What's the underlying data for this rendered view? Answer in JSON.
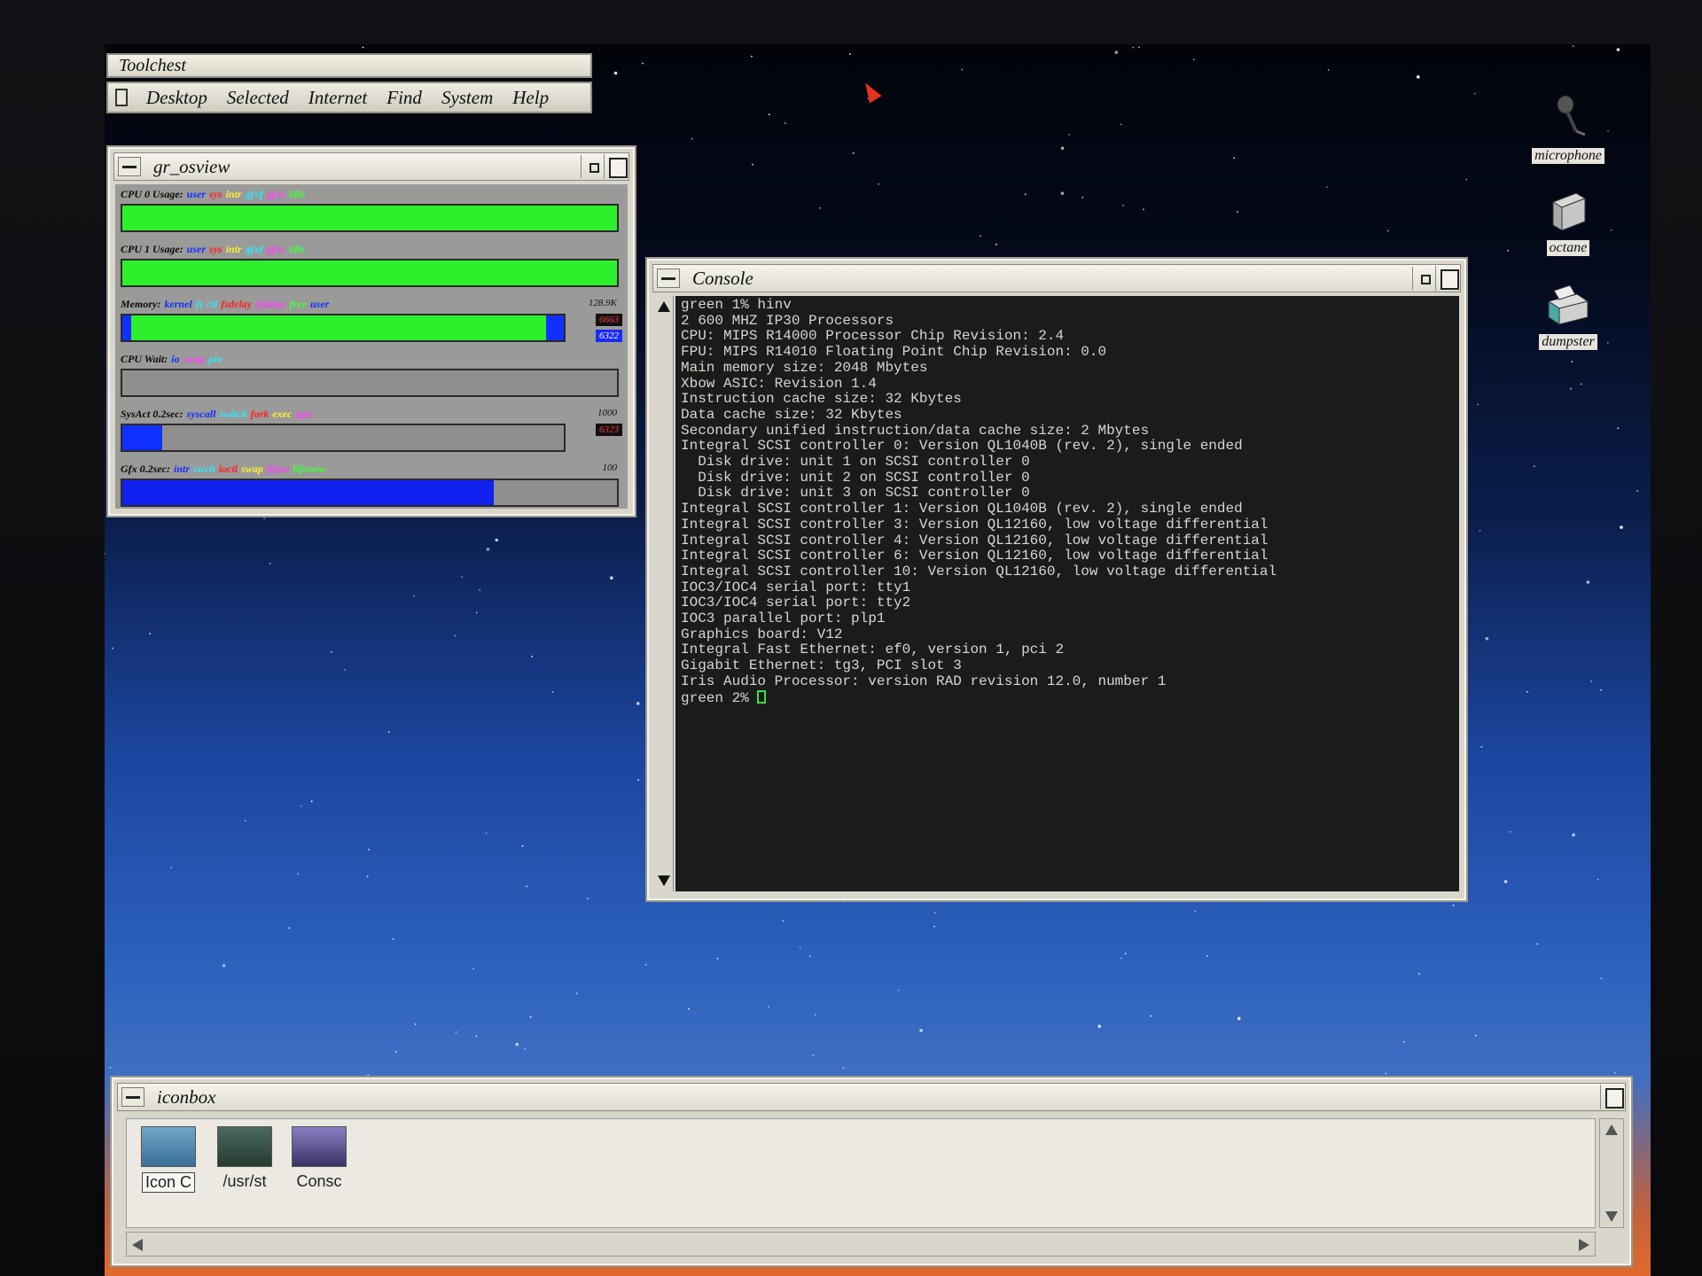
{
  "toolchest": {
    "title": "Toolchest",
    "menu": [
      "Desktop",
      "Selected",
      "Internet",
      "Find",
      "System",
      "Help"
    ]
  },
  "osview": {
    "title": "gr_osview",
    "graphs": [
      {
        "label": "CPU 0 Usage:",
        "legend": [
          {
            "t": "user",
            "c": "#1030ff"
          },
          {
            "t": "sys",
            "c": "#ff2020"
          },
          {
            "t": "intr",
            "c": "#ffee30"
          },
          {
            "t": "gfxf",
            "c": "#30e6ff"
          },
          {
            "t": "gfxc",
            "c": "#ff40ff"
          },
          {
            "t": "idle",
            "c": "#40ff40"
          }
        ],
        "fill": 1.0,
        "fill_color": "#2df02d"
      },
      {
        "label": "CPU 1 Usage:",
        "legend": [
          {
            "t": "user",
            "c": "#1030ff"
          },
          {
            "t": "sys",
            "c": "#ff2020"
          },
          {
            "t": "intr",
            "c": "#ffee30"
          },
          {
            "t": "gfxf",
            "c": "#30e6ff"
          },
          {
            "t": "gfxc",
            "c": "#ff40ff"
          },
          {
            "t": "idle",
            "c": "#40ff40"
          }
        ],
        "fill": 1.0,
        "fill_color": "#2df02d"
      },
      {
        "label": "Memory:",
        "legend": [
          {
            "t": "kernel",
            "c": "#1030ff"
          },
          {
            "t": "fs",
            "c": "#30e6ff"
          },
          {
            "t": "ctl",
            "c": "#30e6ff"
          },
          {
            "t": "fsdelay",
            "c": "#ff2020"
          },
          {
            "t": "fsdelay",
            "c": "#ff40ff"
          },
          {
            "t": "free",
            "c": "#40ff40"
          },
          {
            "t": "user",
            "c": "#1030ff"
          }
        ],
        "fill": 0.96,
        "fill_color": "#2df02d",
        "scale": "128.9K",
        "side": [
          "6663",
          "6322"
        ]
      },
      {
        "label": "CPU Wait:",
        "legend": [
          {
            "t": "io",
            "c": "#1030ff"
          },
          {
            "t": "swap",
            "c": "#ff40ff"
          },
          {
            "t": "pio",
            "c": "#30e6ff"
          }
        ],
        "fill": 0.0,
        "fill_color": "#1030ff"
      },
      {
        "label": "SysAct 0.2sec:",
        "legend": [
          {
            "t": "syscall",
            "c": "#1030ff"
          },
          {
            "t": "switch",
            "c": "#30e6ff"
          },
          {
            "t": "fork",
            "c": "#ff2020"
          },
          {
            "t": "exec",
            "c": "#ffee30"
          },
          {
            "t": "iget",
            "c": "#ff40ff"
          }
        ],
        "fill": 0.09,
        "fill_color": "#1030ff",
        "scale": "1000",
        "side": [
          "6323"
        ]
      },
      {
        "label": "Gfx 0.2sec:",
        "legend": [
          {
            "t": "intr",
            "c": "#1030ff"
          },
          {
            "t": "swch",
            "c": "#30e6ff"
          },
          {
            "t": "ioctl",
            "c": "#ff2020"
          },
          {
            "t": "swap",
            "c": "#ffee30"
          },
          {
            "t": "fifow",
            "c": "#ff40ff"
          },
          {
            "t": "fifonow",
            "c": "#40ff40"
          }
        ],
        "fill": 0.75,
        "fill_color": "#1020ee",
        "scale": "100"
      }
    ]
  },
  "console": {
    "title": "Console",
    "lines": [
      "green 1% hinv",
      "2 600 MHZ IP30 Processors",
      "CPU: MIPS R14000 Processor Chip Revision: 2.4",
      "FPU: MIPS R14010 Floating Point Chip Revision: 0.0",
      "Main memory size: 2048 Mbytes",
      "Xbow ASIC: Revision 1.4",
      "Instruction cache size: 32 Kbytes",
      "Data cache size: 32 Kbytes",
      "Secondary unified instruction/data cache size: 2 Mbytes",
      "Integral SCSI controller 0: Version QL1040B (rev. 2), single ended",
      "  Disk drive: unit 1 on SCSI controller 0",
      "  Disk drive: unit 2 on SCSI controller 0",
      "  Disk drive: unit 3 on SCSI controller 0",
      "Integral SCSI controller 1: Version QL1040B (rev. 2), single ended",
      "Integral SCSI controller 3: Version QL12160, low voltage differential",
      "Integral SCSI controller 4: Version QL12160, low voltage differential",
      "Integral SCSI controller 6: Version QL12160, low voltage differential",
      "Integral SCSI controller 10: Version QL12160, low voltage differential",
      "IOC3/IOC4 serial port: tty1",
      "IOC3/IOC4 serial port: tty2",
      "IOC3 parallel port: plp1",
      "Graphics board: V12",
      "Integral Fast Ethernet: ef0, version 1, pci 2",
      "Gigabit Ethernet: tg3, PCI slot 3",
      "Iris Audio Processor: version RAD revision 12.0, number 1"
    ],
    "prompt": "green 2% "
  },
  "desktop_icons": [
    "microphone",
    "octane",
    "dumpster"
  ],
  "iconbox": {
    "title": "iconbox",
    "items": [
      "Icon C",
      "/usr/st",
      "Consc"
    ]
  }
}
